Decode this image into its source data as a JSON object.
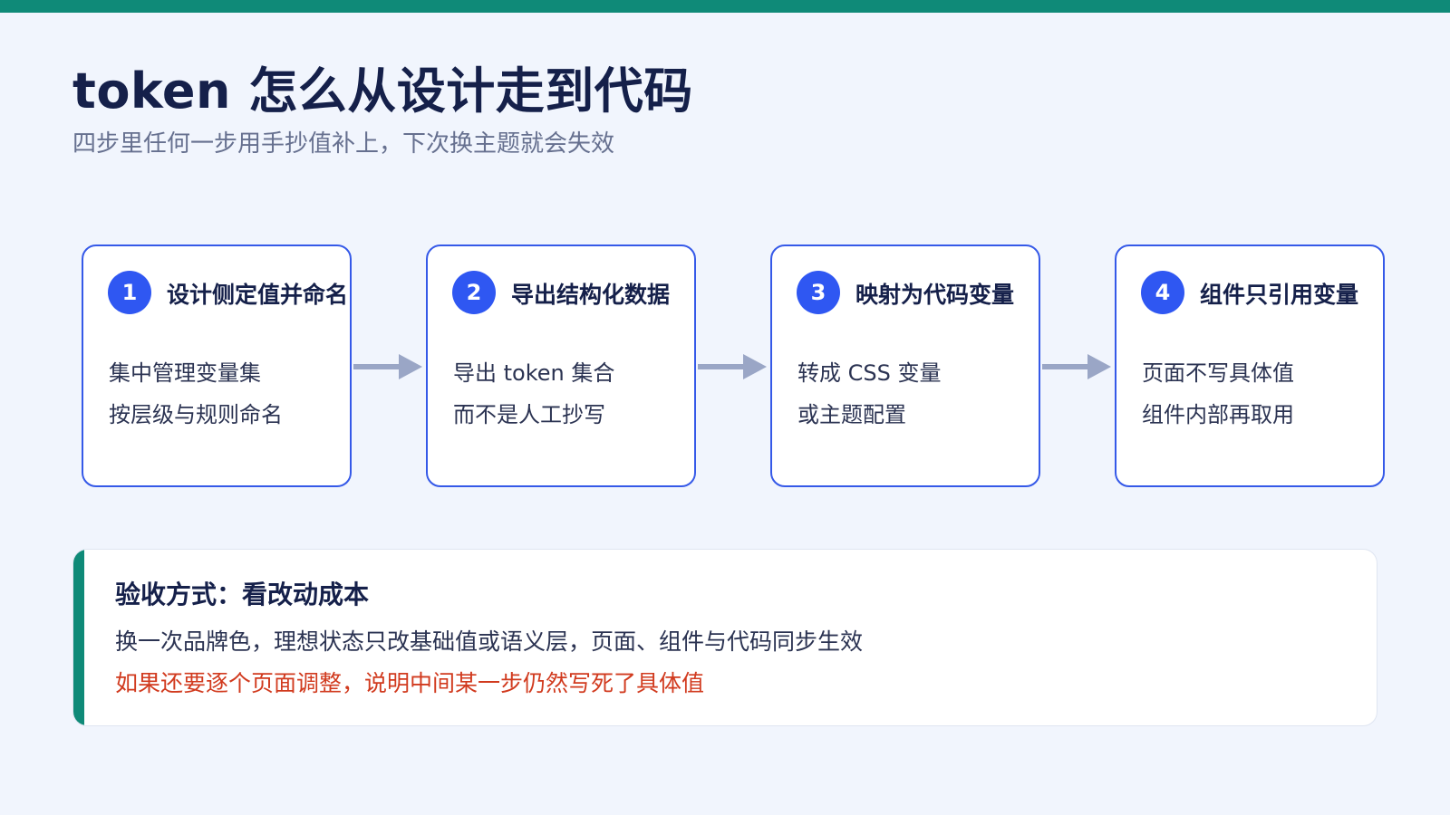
{
  "header": {
    "title": "token 怎么从设计走到代码",
    "subtitle": "四步里任何一步用手抄值补上，下次换主题就会失效"
  },
  "steps": [
    {
      "number": "1",
      "title": "设计侧定值并命名",
      "lines": [
        "集中管理变量集",
        "按层级与规则命名"
      ]
    },
    {
      "number": "2",
      "title": "导出结构化数据",
      "lines": [
        "导出 token 集合",
        "而不是人工抄写"
      ]
    },
    {
      "number": "3",
      "title": "映射为代码变量",
      "lines": [
        "转成 CSS 变量",
        "或主题配置"
      ]
    },
    {
      "number": "4",
      "title": "组件只引用变量",
      "lines": [
        "页面不写具体值",
        "组件内部再取用"
      ]
    }
  ],
  "note": {
    "title": "验收方式：看改动成本",
    "line1": "换一次品牌色，理想状态只改基础值或语义层，页面、组件与代码同步生效",
    "line2": "如果还要逐个页面调整，说明中间某一步仍然写死了具体值"
  },
  "colors": {
    "accent_teal": "#0f8a78",
    "accent_blue": "#2f57f2",
    "warning_red": "#d13a1e",
    "arrow_gray": "#9aa6c6"
  }
}
